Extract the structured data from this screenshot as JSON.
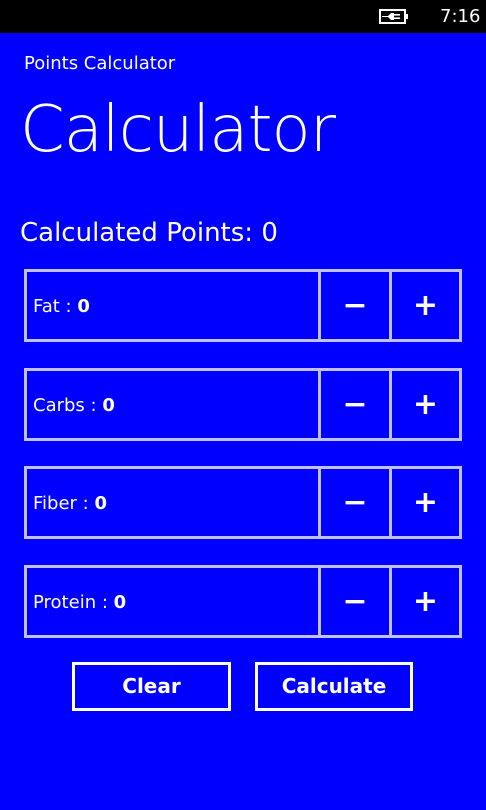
{
  "status_bar": {
    "battery_icon": "battery-charging-icon",
    "time": "7:16"
  },
  "header": {
    "app_title": "Points Calculator",
    "page_title": "Calculator"
  },
  "result": {
    "label": "Calculated Points:",
    "value": "0"
  },
  "nutrients": [
    {
      "label": "Fat :",
      "value": "0"
    },
    {
      "label": "Carbs :",
      "value": "0"
    },
    {
      "label": "Fiber :",
      "value": "0"
    },
    {
      "label": "Protein :",
      "value": "0"
    }
  ],
  "controls": {
    "minus": "−",
    "plus": "+"
  },
  "buttons": {
    "clear": "Clear",
    "calculate": "Calculate"
  },
  "colors": {
    "background": "#0000ff",
    "border": "#c0c0ff",
    "text": "#ffffff"
  }
}
